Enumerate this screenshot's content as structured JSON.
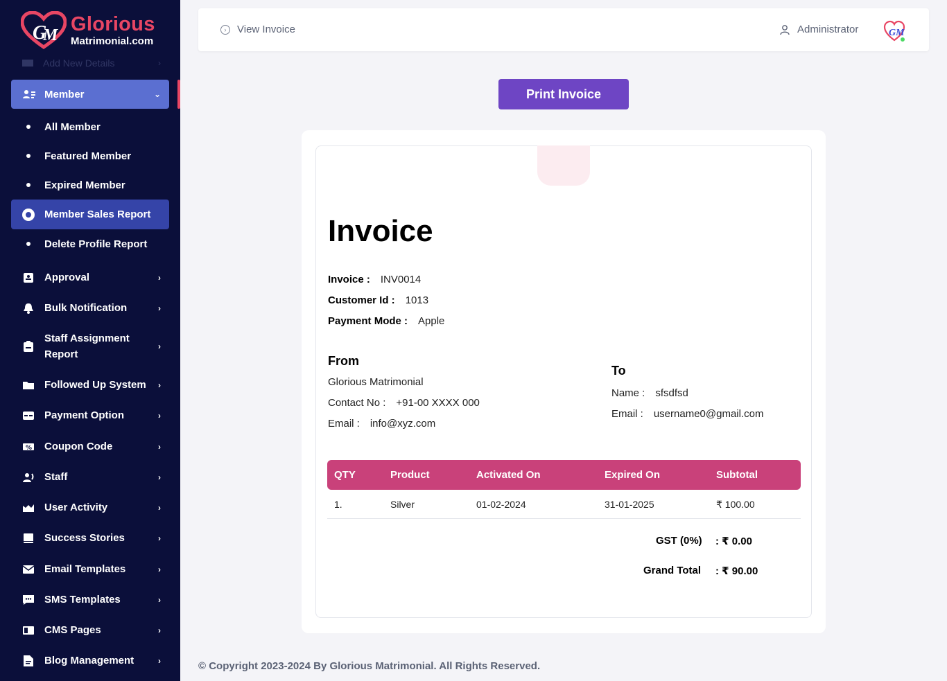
{
  "brand": {
    "name": "Glorious",
    "domain": "Matrimonial.com",
    "accent": "#e84664"
  },
  "sidebar": {
    "faded_item": "Add New Details",
    "member": {
      "label": "Member",
      "icon": "members-icon"
    },
    "member_sub": [
      {
        "label": "All Member"
      },
      {
        "label": "Featured Member"
      },
      {
        "label": "Expired Member"
      },
      {
        "label": "Member Sales Report",
        "active": true
      },
      {
        "label": "Delete Profile Report"
      }
    ],
    "items": [
      {
        "label": "Approval",
        "icon": "approval-icon"
      },
      {
        "label": "Bulk Notification",
        "icon": "bell-icon"
      },
      {
        "label": "Staff Assignment Report",
        "icon": "clipboard-icon"
      },
      {
        "label": "Followed Up System",
        "icon": "folder-icon"
      },
      {
        "label": "Payment Option",
        "icon": "card-icon"
      },
      {
        "label": "Coupon Code",
        "icon": "coupon-icon"
      },
      {
        "label": "Staff",
        "icon": "staff-icon"
      },
      {
        "label": "User Activity",
        "icon": "activity-icon"
      },
      {
        "label": "Success Stories",
        "icon": "book-icon"
      },
      {
        "label": "Email Templates",
        "icon": "mail-icon"
      },
      {
        "label": "SMS Templates",
        "icon": "sms-icon"
      },
      {
        "label": "CMS Pages",
        "icon": "pages-icon"
      },
      {
        "label": "Blog Management",
        "icon": "blog-icon"
      }
    ]
  },
  "header": {
    "breadcrumb": "View Invoice",
    "user": "Administrator"
  },
  "print_button": "Print Invoice",
  "invoice": {
    "title": "Invoice",
    "meta": [
      {
        "key": "Invoice :",
        "value": "INV0014"
      },
      {
        "key": "Customer Id :",
        "value": "1013"
      },
      {
        "key": "Payment Mode :",
        "value": "Apple"
      }
    ],
    "from": {
      "title": "From",
      "company": "Glorious Matrimonial",
      "contact_key": "Contact No :",
      "contact_value": "+91-00 XXXX 000",
      "email_key": "Email :",
      "email_value": "info@xyz.com"
    },
    "to": {
      "title": "To",
      "name_key": "Name :",
      "name_value": "sfsdfsd",
      "email_key": "Email :",
      "email_value": "username0@gmail.com"
    },
    "table": {
      "headers": [
        "QTY",
        "Product",
        "Activated On",
        "Expired On",
        "Subtotal"
      ],
      "rows": [
        [
          "1.",
          "Silver",
          "01-02-2024",
          "31-01-2025",
          "₹ 100.00"
        ]
      ],
      "header_color": "#c9417a"
    },
    "totals": {
      "gst_label": "GST (0%)",
      "gst_value": ": ₹ 0.00",
      "grand_label": "Grand Total",
      "grand_value": ": ₹ 90.00"
    }
  },
  "footer": "© Copyright 2023-2024 By Glorious Matrimonial. All Rights Reserved."
}
